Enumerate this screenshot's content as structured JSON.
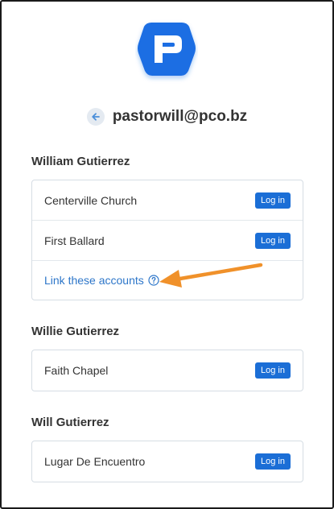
{
  "account": {
    "email": "pastorwill@pco.bz"
  },
  "icons": {
    "logo": "planning-center-logo",
    "back": "arrow-left-icon",
    "help": "question-circle-icon",
    "annotation": "arrow-annotation"
  },
  "colors": {
    "brand": "#1f6ee3",
    "button": "#1b6ed6",
    "link": "#2d76c9",
    "annotation_arrow": "#f0912a"
  },
  "people": [
    {
      "name": "William Gutierrez",
      "organizations": [
        {
          "name": "Centerville Church",
          "action": "Log in"
        },
        {
          "name": "First Ballard",
          "action": "Log in"
        }
      ],
      "link_label": "Link these accounts"
    },
    {
      "name": "Willie Gutierrez",
      "organizations": [
        {
          "name": "Faith Chapel",
          "action": "Log in"
        }
      ]
    },
    {
      "name": "Will Gutierrez",
      "organizations": [
        {
          "name": "Lugar De Encuentro",
          "action": "Log in"
        }
      ]
    }
  ]
}
